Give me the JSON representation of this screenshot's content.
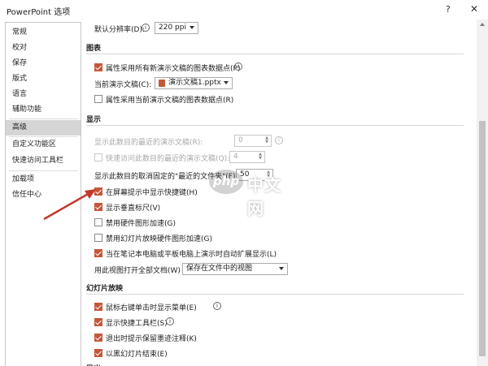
{
  "window": {
    "title": "PowerPoint 选项",
    "help_label": "?",
    "close_label": "✕"
  },
  "sidebar": {
    "items": [
      {
        "label": "常规"
      },
      {
        "label": "校对"
      },
      {
        "label": "保存"
      },
      {
        "label": "版式"
      },
      {
        "label": "语言"
      },
      {
        "label": "辅助功能"
      },
      {
        "label": "高级"
      },
      {
        "label": "自定义功能区"
      },
      {
        "label": "快速访问工具栏"
      },
      {
        "label": "加载项"
      },
      {
        "label": "信任中心"
      }
    ],
    "active_index": 6
  },
  "main": {
    "resolution": {
      "label": "默认分辨率(D):",
      "value": "220 ppi"
    },
    "chart": {
      "title": "图表",
      "prop_follow_all": {
        "label": "属性采用所有新演示文稿的图表数据点(P)",
        "checked": true
      },
      "current_label": "当前演示文稿(C):",
      "current_value": "演示文稿1.pptx",
      "prop_follow_current": {
        "label": "属性采用当前演示文稿的图表数据点(R)",
        "checked": false
      }
    },
    "display": {
      "title": "显示",
      "recent_count": {
        "label": "显示此数目的最近的演示文稿(R):",
        "value": "0"
      },
      "quick_access": {
        "label": "快速访问此数目的最近的演示文稿(Q):",
        "value": "4",
        "checked": false
      },
      "unpinned_folders": {
        "label": "显示此数目的取消固定的\"最近的文件夹\"(F):",
        "value": "50"
      },
      "show_shortcut": {
        "label": "在屏幕提示中显示快捷键(H)",
        "checked": true
      },
      "vertical_ruler": {
        "label": "显示垂直标尺(V)",
        "checked": true
      },
      "disable_hw_accel": {
        "label": "禁用硬件图形加速(G)",
        "checked": false
      },
      "disable_slide_hw_accel": {
        "label": "禁用幻灯片放映硬件图形加速(G)",
        "checked": false
      },
      "auto_extend": {
        "label": "当在笔记本电脑或平板电脑上演示时自动扩展显示(L)",
        "checked": true
      },
      "open_view_label": "用此视图打开全部文档(W)",
      "open_view_value": "保存在文件中的视图"
    },
    "slideshow": {
      "title": "幻灯片放映",
      "right_click_menu": {
        "label": "鼠标右键单击时显示菜单(E)",
        "checked": true
      },
      "popup_toolbar": {
        "label": "显示快捷工具栏(S)",
        "checked": true
      },
      "keep_ink": {
        "label": "退出时提示保留墨迹注释(K)",
        "checked": true
      },
      "end_black": {
        "label": "以黑幻灯片结束(E)",
        "checked": true
      }
    },
    "print": {
      "title": "导出"
    }
  },
  "watermark": {
    "brand": "php",
    "text": "中文网"
  },
  "colors": {
    "accent": "#c4573a",
    "active_nav": "#d5d5d5",
    "arrow": "#c0392b"
  }
}
